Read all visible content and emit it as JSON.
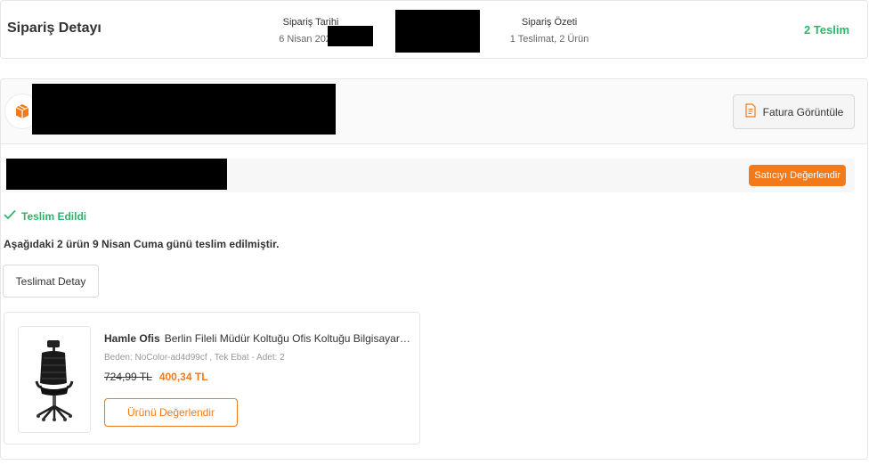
{
  "header": {
    "title": "Sipariş Detayı",
    "order_date_label": "Sipariş Tarihi",
    "order_date_value": "6 Nisan 2021 -",
    "order_summary_label": "Sipariş Özeti",
    "order_summary_value": "1 Teslimat, 2 Ürün",
    "delivered_count": "2 Teslim"
  },
  "shipment": {
    "invoice_button": "Fatura Görüntüle",
    "rate_seller_button": "Satıcıyı Değerlendir",
    "status": "Teslim Edildi",
    "delivery_note": "Aşağıdaki 2 ürün 9 Nisan Cuma günü teslim edilmiştir.",
    "delivery_detail_button": "Teslimat Detay"
  },
  "product": {
    "brand": "Hamle Ofis",
    "name": "Berlin Fileli Müdür Koltuğu Ofis Koltuğu Bilgisayar Koltuğu",
    "variant": "Beden: NoColor-ad4d99cf , Tek Ebat - Adet: 2",
    "old_price": "724,99 TL",
    "new_price": "400,34 TL",
    "rate_button": "Ürünü Değerlendir"
  },
  "colors": {
    "accent": "#f27a1a",
    "success": "#2db56b"
  },
  "icons": {
    "box": "box-icon",
    "invoice": "invoice-icon",
    "check": "check-icon",
    "chair": "office-chair-image"
  }
}
